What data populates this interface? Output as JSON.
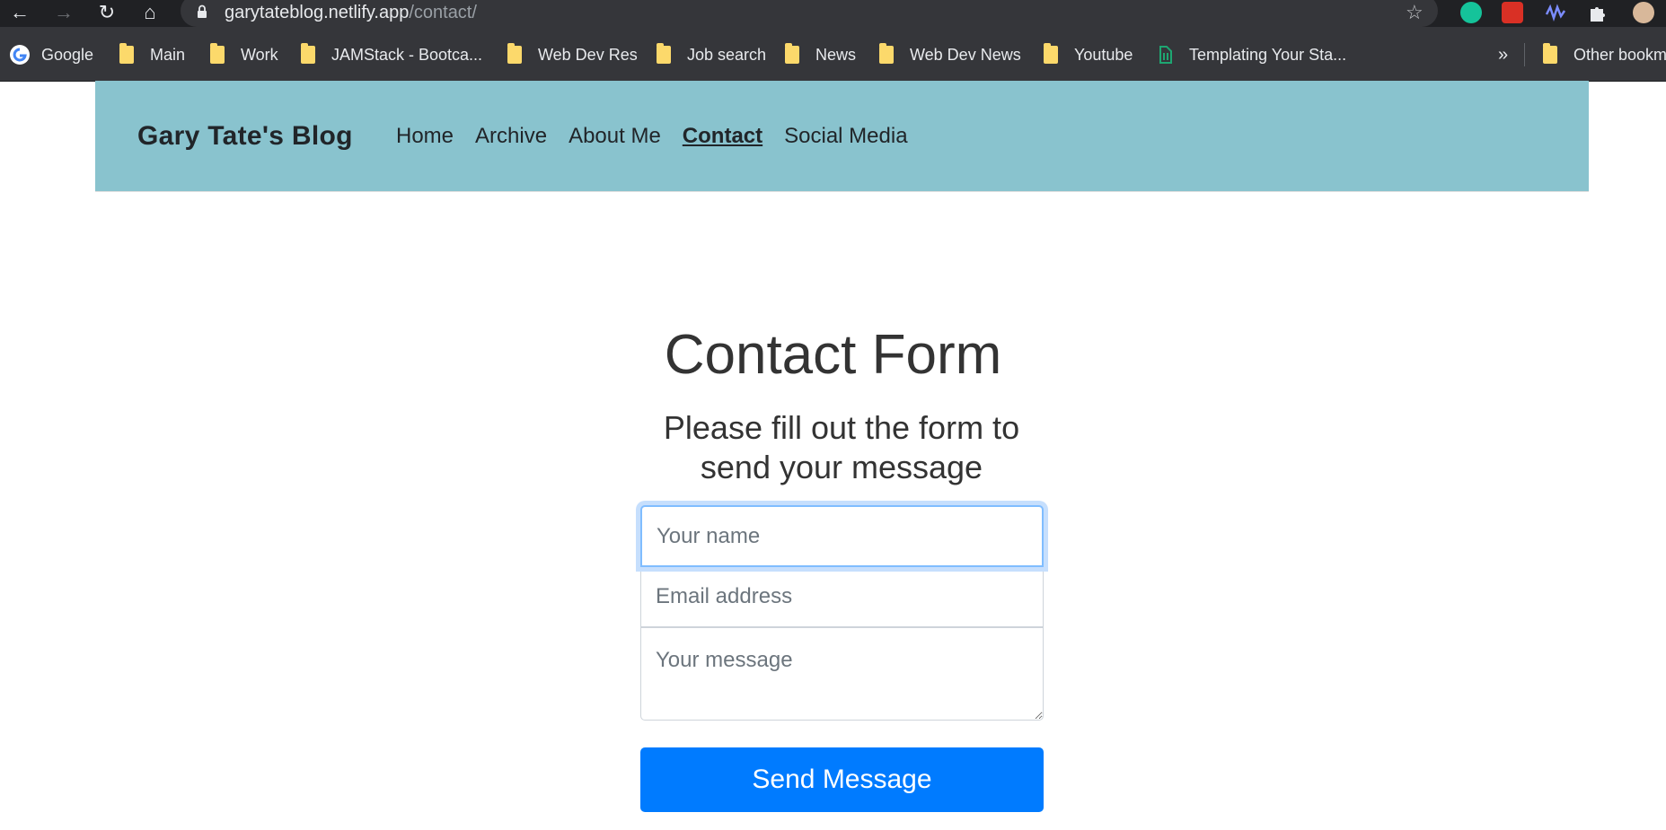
{
  "browser": {
    "url_host": "garytateblog.netlify.app",
    "url_path": "/contact/",
    "bookmarks": [
      {
        "label": "Google",
        "icon": "google-icon"
      },
      {
        "label": "Main",
        "icon": "folder-icon"
      },
      {
        "label": "Work",
        "icon": "folder-icon"
      },
      {
        "label": "JAMStack - Bootca...",
        "icon": "folder-icon"
      },
      {
        "label": "Web Dev Res",
        "icon": "folder-icon"
      },
      {
        "label": "Job search",
        "icon": "folder-icon"
      },
      {
        "label": "News",
        "icon": "folder-icon"
      },
      {
        "label": "Web Dev News",
        "icon": "folder-icon"
      },
      {
        "label": "Youtube",
        "icon": "folder-icon"
      },
      {
        "label": "Templating Your Sta...",
        "icon": "page-icon"
      }
    ],
    "more_label": "»",
    "other_bookmarks": "Other bookm"
  },
  "site": {
    "brand": "Gary Tate's Blog",
    "nav": [
      "Home",
      "Archive",
      "About Me",
      "Contact",
      "Social Media"
    ],
    "active_nav": "Contact",
    "header_color": "#89c3ce"
  },
  "contact": {
    "title": "Contact Form",
    "subtitle": "Please fill out the form to send your message",
    "name_placeholder": "Your name",
    "email_placeholder": "Email address",
    "message_placeholder": "Your message",
    "send_label": "Send Message",
    "button_color": "#007bff"
  }
}
